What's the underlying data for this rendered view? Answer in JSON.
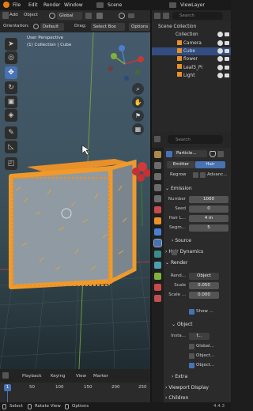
{
  "menubar": {
    "items": [
      "File",
      "Edit",
      "Render",
      "Window"
    ],
    "scene": "Scene",
    "view_layer": "ViewLayer"
  },
  "viewport_header": {
    "add": "Add",
    "object": "Object",
    "orientation_mode": "Global"
  },
  "tool_settings": {
    "orientation_label": "Orientation:",
    "orientation_value": "Default",
    "drag_label": "Drag:",
    "drag_value": "Select Box",
    "options": "Options"
  },
  "viewport": {
    "view_name": "User Perspective",
    "context": "(1) Collection | Cube"
  },
  "outliner": {
    "search_placeholder": "Search",
    "items": [
      "Scene Collection",
      "Collection",
      "Camera",
      "Cube",
      "flower",
      "Leaf3_Pl",
      "Light"
    ],
    "selected_index": 3
  },
  "properties": {
    "search_placeholder": "Search",
    "system_name": "Particle...",
    "type_tabs": [
      "Emitter",
      "Hair"
    ],
    "active_type": "Hair",
    "regrow_label": "Regrow",
    "advanced_label": "Advanc...",
    "emission": {
      "title": "Emission",
      "number_label": "Number",
      "number": "1000",
      "seed_label": "Seed",
      "seed": "0",
      "hair_length_label": "Hair L...",
      "hair_length": "4 m",
      "segments_label": "Segm...",
      "segments": "5"
    },
    "source_title": "Source",
    "hair_dynamics_title": "Hair Dynamics",
    "render": {
      "title": "Render",
      "render_as_label": "Rend...",
      "render_as": "Object",
      "scale_label": "Scale",
      "scale": "0.050",
      "scale_rand_label": "Scale ...",
      "scale_rand": "0.000",
      "show_emitter_label": "Show ..."
    },
    "object_panel": {
      "title": "Object",
      "instance_label": "Insta...",
      "instance_value": "f...",
      "global_label": "Global...",
      "object_rot_label": "Object...",
      "object_scale_label": "Object..."
    },
    "extra_title": "Extra",
    "viewport_display_title": "Viewport Display",
    "children_title": "Children"
  },
  "timeline": {
    "playback": "Playback",
    "keying": "Keying",
    "view": "View",
    "marker": "Marker",
    "current_frame": "1",
    "frame_ticks": [
      "1",
      "50",
      "100",
      "150",
      "200",
      "250"
    ]
  },
  "statusbar": {
    "select": "Select",
    "rotate_view": "Rotate View",
    "options": "Options",
    "version": "4.4.3"
  },
  "colors": {
    "accent": "#4772b3",
    "selection_orange": "#f09a2b",
    "hair_orange": "#e8902a",
    "x_axis": "#c23a3a",
    "y_axis": "#7fb23a",
    "panel": "#2b2b2b"
  }
}
